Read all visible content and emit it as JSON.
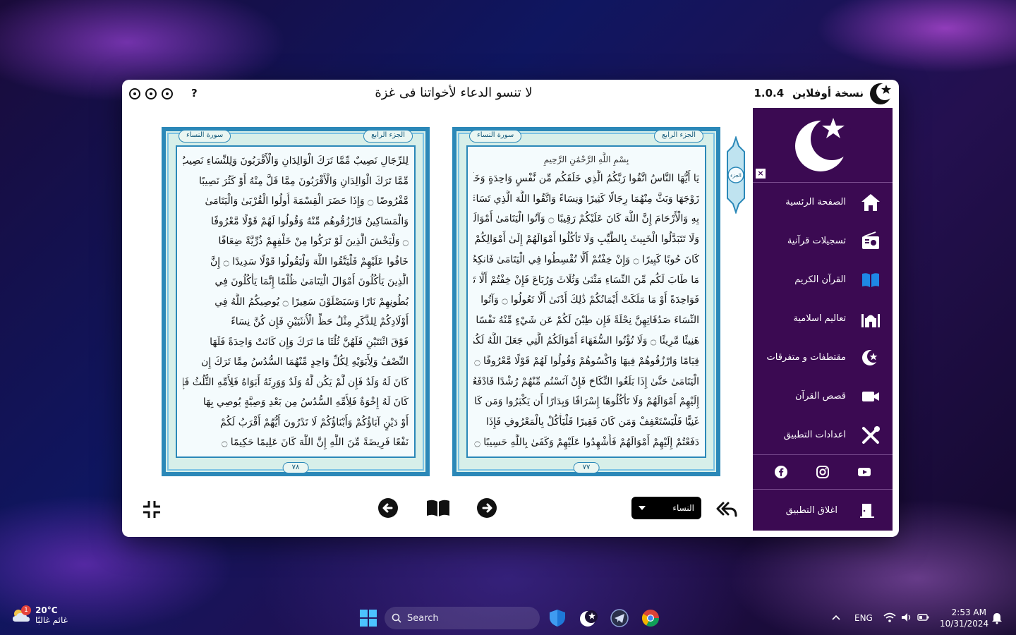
{
  "app": {
    "banner": "لا تنسو الدعاء لأخواتنا فى غزة",
    "help_label": "?",
    "version_title": "نسخة أوفلاين",
    "version_number": "1.0.4"
  },
  "sidebar": {
    "close_label": "×",
    "items": [
      {
        "label": "الصفحة الرئسية",
        "icon": "home-icon"
      },
      {
        "label": "تسجيلات قرآنية",
        "icon": "radio-icon"
      },
      {
        "label": "القرآن الكريم",
        "icon": "book-icon"
      },
      {
        "label": "تعاليم اسلامية",
        "icon": "mosque-icon"
      },
      {
        "label": "مقتطفات و متفرقات",
        "icon": "crescent-star-icon"
      },
      {
        "label": "قصص القرآن",
        "icon": "video-icon"
      },
      {
        "label": "اعدادات التطبيق",
        "icon": "tools-icon"
      }
    ],
    "social": [
      "facebook-icon",
      "instagram-icon",
      "youtube-icon"
    ],
    "exit_label": "اغلاق التطبيق"
  },
  "mushaf": {
    "left_page": {
      "juz": "الجزء الرابع",
      "surah": "سورة النساء",
      "number": "٧٨",
      "lines": [
        "لِلرِّجَالِ نَصِيبٌ مِّمَّا تَرَكَ الْوَالِدَانِ وَالْأَقْرَبُونَ وَلِلنِّسَاءِ نَصِيبٌ",
        "مِّمَّا تَرَكَ الْوَالِدَانِ وَالْأَقْرَبُونَ مِمَّا قَلَّ مِنْهُ أَوْ كَثُرَ نَصِيبًا",
        "مَّفْرُوضًا ۝ وَإِذَا حَضَرَ الْقِسْمَةَ أُولُوا الْقُرْبَىٰ وَالْيَتَامَىٰ",
        "وَالْمَسَاكِينُ فَارْزُقُوهُم مِّنْهُ وَقُولُوا لَهُمْ قَوْلًا مَّعْرُوفًا",
        "۝ وَلْيَخْشَ الَّذِينَ لَوْ تَرَكُوا مِنْ خَلْفِهِمْ ذُرِّيَّةً ضِعَافًا",
        "خَافُوا عَلَيْهِمْ فَلْيَتَّقُوا اللَّهَ وَلْيَقُولُوا قَوْلًا سَدِيدًا ۝ إِنَّ",
        "الَّذِينَ يَأْكُلُونَ أَمْوَالَ الْيَتَامَىٰ ظُلْمًا إِنَّمَا يَأْكُلُونَ فِي",
        "بُطُونِهِمْ نَارًا وَسَيَصْلَوْنَ سَعِيرًا ۝ يُوصِيكُمُ اللَّهُ فِي",
        "أَوْلَادِكُمْ لِلذَّكَرِ مِثْلُ حَظِّ الْأُنثَيَيْنِ فَإِن كُنَّ نِسَاءً",
        "فَوْقَ اثْنَتَيْنِ فَلَهُنَّ ثُلُثَا مَا تَرَكَ وَإِن كَانَتْ وَاحِدَةً فَلَهَا",
        "النِّصْفُ وَلِأَبَوَيْهِ لِكُلِّ وَاحِدٍ مِّنْهُمَا السُّدُسُ مِمَّا تَرَكَ إِن",
        "كَانَ لَهُ وَلَدٌ فَإِن لَّمْ يَكُن لَّهُ وَلَدٌ وَوَرِثَهُ أَبَوَاهُ فَلِأُمِّهِ الثُّلُثُ فَإِن",
        "كَانَ لَهُ إِخْوَةٌ فَلِأُمِّهِ السُّدُسُ مِن بَعْدِ وَصِيَّةٍ يُوصِي بِهَا",
        "أَوْ دَيْنٍ آبَاؤُكُمْ وَأَبْنَاؤُكُمْ لَا تَدْرُونَ أَيُّهُمْ أَقْرَبُ لَكُمْ",
        "نَفْعًا فَرِيضَةً مِّنَ اللَّهِ إِنَّ اللَّهَ كَانَ عَلِيمًا حَكِيمًا ۝"
      ]
    },
    "right_page": {
      "juz": "الجزء الرابع",
      "surah": "سورة النساء",
      "number": "٧٧",
      "basmala": "بِسْمِ اللَّهِ الرَّحْمَٰنِ الرَّحِيمِ",
      "lines": [
        "يَا أَيُّهَا النَّاسُ اتَّقُوا رَبَّكُمُ الَّذِي خَلَقَكُم مِّن نَّفْسٍ وَاحِدَةٍ وَخَلَقَ مِنْهَا",
        "زَوْجَهَا وَبَثَّ مِنْهُمَا رِجَالًا كَثِيرًا وَنِسَاءً وَاتَّقُوا اللَّهَ الَّذِي تَسَاءَلُونَ",
        "بِهِ وَالْأَرْحَامَ إِنَّ اللَّهَ كَانَ عَلَيْكُمْ رَقِيبًا ۝ وَآتُوا الْيَتَامَىٰ أَمْوَالَهُمْ",
        "وَلَا تَتَبَدَّلُوا الْخَبِيثَ بِالطَّيِّبِ وَلَا تَأْكُلُوا أَمْوَالَهُمْ إِلَىٰ أَمْوَالِكُمْ إِنَّهُ",
        "كَانَ حُوبًا كَبِيرًا ۝ وَإِنْ خِفْتُمْ أَلَّا تُقْسِطُوا فِي الْيَتَامَىٰ فَانكِحُوا",
        "مَا طَابَ لَكُم مِّنَ النِّسَاءِ مَثْنَىٰ وَثُلَاثَ وَرُبَاعَ فَإِنْ خِفْتُمْ أَلَّا تَعْدِلُوا",
        "فَوَاحِدَةً أَوْ مَا مَلَكَتْ أَيْمَانُكُمْ ذَٰلِكَ أَدْنَىٰ أَلَّا تَعُولُوا ۝ وَآتُوا",
        "النِّسَاءَ صَدُقَاتِهِنَّ نِحْلَةً فَإِن طِبْنَ لَكُمْ عَن شَيْءٍ مِّنْهُ نَفْسًا فَكُلُوهُ",
        "هَنِيئًا مَّرِيئًا ۝ وَلَا تُؤْتُوا السُّفَهَاءَ أَمْوَالَكُمُ الَّتِي جَعَلَ اللَّهُ لَكُمْ",
        "قِيَامًا وَارْزُقُوهُمْ فِيهَا وَاكْسُوهُمْ وَقُولُوا لَهُمْ قَوْلًا مَّعْرُوفًا ۝ وَابْتَلُوا",
        "الْيَتَامَىٰ حَتَّىٰ إِذَا بَلَغُوا النِّكَاحَ فَإِنْ آنَسْتُم مِّنْهُمْ رُشْدًا فَادْفَعُوا",
        "إِلَيْهِمْ أَمْوَالَهُمْ وَلَا تَأْكُلُوهَا إِسْرَافًا وَبِدَارًا أَن يَكْبَرُوا وَمَن كَانَ",
        "غَنِيًّا فَلْيَسْتَعْفِفْ وَمَن كَانَ فَقِيرًا فَلْيَأْكُلْ بِالْمَعْرُوفِ فَإِذَا",
        "دَفَعْتُمْ إِلَيْهِمْ أَمْوَالَهُمْ فَأَشْهِدُوا عَلَيْهِمْ وَكَفَىٰ بِاللَّهِ حَسِيبًا ۝"
      ]
    },
    "juz_marker": "الجزء"
  },
  "toolbar": {
    "surah_selected": "النساء"
  },
  "taskbar": {
    "weather_temp": "20°C",
    "weather_cond": "غائم غالبًا",
    "weather_badge": "1",
    "search_placeholder": "Search",
    "lang": "ENG",
    "time": "2:53 AM",
    "date": "10/31/2024"
  },
  "colors": {
    "sidebar_bg": "#3b0a52",
    "page_border": "#2b88b8",
    "page_bg": "#d7efe9"
  }
}
